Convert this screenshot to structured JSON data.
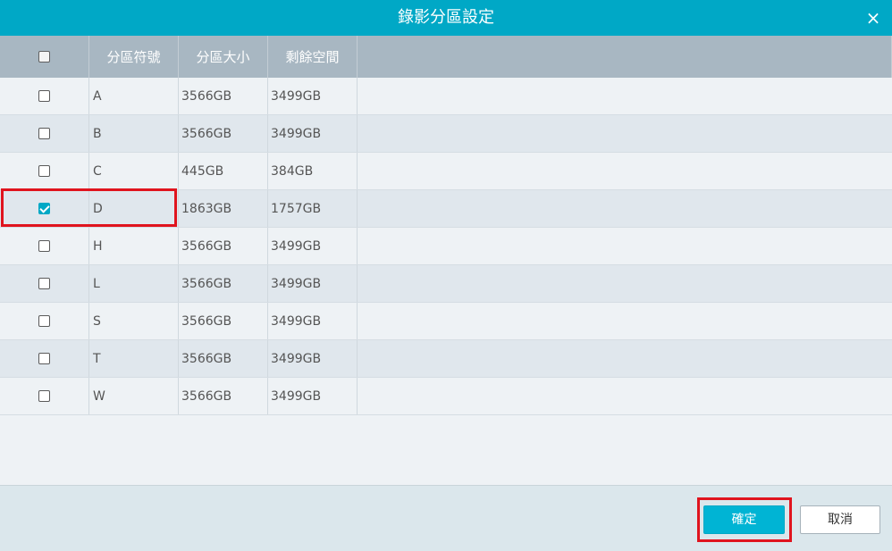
{
  "dialog": {
    "title": "錄影分區設定",
    "close_label": "×"
  },
  "table": {
    "headers": {
      "select_all": false,
      "letter": "分區符號",
      "size": "分區大小",
      "free": "剩餘空間"
    },
    "rows": [
      {
        "letter": "A",
        "size": "3566GB",
        "free": "3499GB",
        "checked": false
      },
      {
        "letter": "B",
        "size": "3566GB",
        "free": "3499GB",
        "checked": false
      },
      {
        "letter": "C",
        "size": "445GB",
        "free": "384GB",
        "checked": false
      },
      {
        "letter": "D",
        "size": "1863GB",
        "free": "1757GB",
        "checked": true
      },
      {
        "letter": "H",
        "size": "3566GB",
        "free": "3499GB",
        "checked": false
      },
      {
        "letter": "L",
        "size": "3566GB",
        "free": "3499GB",
        "checked": false
      },
      {
        "letter": "S",
        "size": "3566GB",
        "free": "3499GB",
        "checked": false
      },
      {
        "letter": "T",
        "size": "3566GB",
        "free": "3499GB",
        "checked": false
      },
      {
        "letter": "W",
        "size": "3566GB",
        "free": "3499GB",
        "checked": false
      }
    ]
  },
  "footer": {
    "ok_label": "確定",
    "cancel_label": "取消"
  },
  "colors": {
    "titlebar": "#00a8c6",
    "header": "#a8b7c2",
    "ok_button": "#00b4d4",
    "highlight": "#e0141e"
  }
}
